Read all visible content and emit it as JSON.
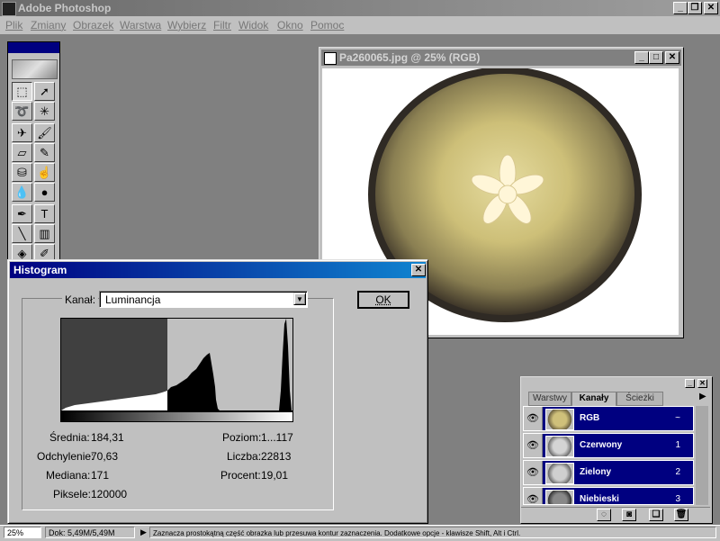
{
  "app": {
    "title": "Adobe Photoshop"
  },
  "menu": {
    "items": [
      "Plik",
      "Zmiany",
      "Obrazek",
      "Warstwa",
      "Wybierz",
      "Filtr",
      "Widok",
      "Okno",
      "Pomoc"
    ]
  },
  "document": {
    "title": "Pa260065.jpg @ 25% (RGB)"
  },
  "histogram": {
    "title": "Histogram",
    "channel_label": "Kanał:",
    "channel_value": "Luminancja",
    "ok_label": "OK",
    "stats_left": [
      {
        "label": "Średnia:",
        "value": "184,31"
      },
      {
        "label": "Odchylenie:",
        "value": "70,63"
      },
      {
        "label": "Mediana:",
        "value": "171"
      },
      {
        "label": "Piksele:",
        "value": "120000"
      }
    ],
    "stats_right": [
      {
        "label": "Poziom:",
        "value": "1...117"
      },
      {
        "label": "Liczba:",
        "value": "22813"
      },
      {
        "label": "Procent:",
        "value": "19,01"
      }
    ]
  },
  "channels_palette": {
    "tabs": [
      "Warstwy",
      "Kanały",
      "Ścieżki"
    ],
    "active_tab": "Kanały",
    "rows": [
      {
        "name": "RGB",
        "key": "~"
      },
      {
        "name": "Czerwony",
        "key": "1"
      },
      {
        "name": "Zielony",
        "key": "2"
      },
      {
        "name": "Niebieski",
        "key": "3"
      }
    ]
  },
  "status": {
    "zoom": "25%",
    "doc_size": "Dok: 5,49M/5,49M",
    "hint": "Zaznacza prostokątną część obrazka lub przesuwa kontur zaznaczenia. Dodatkowe opcje - klawisze Shift, Alt i Ctrl."
  },
  "colors": {
    "active_title": "#000080",
    "inactive_title": "#808080",
    "face": "#c0c0c0",
    "desktop": "#808080"
  }
}
